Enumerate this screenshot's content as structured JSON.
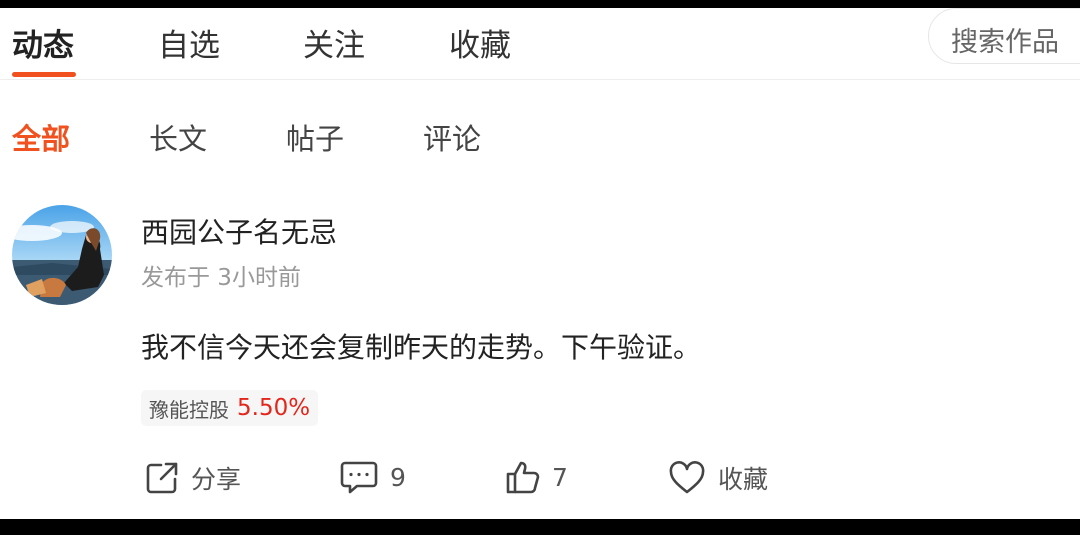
{
  "top_tabs": [
    {
      "label": "动态",
      "active": true
    },
    {
      "label": "自选",
      "active": false
    },
    {
      "label": "关注",
      "active": false
    },
    {
      "label": "收藏",
      "active": false
    }
  ],
  "search": {
    "placeholder": "搜索作品"
  },
  "sub_tabs": [
    {
      "label": "全部",
      "active": true
    },
    {
      "label": "长文",
      "active": false
    },
    {
      "label": "帖子",
      "active": false
    },
    {
      "label": "评论",
      "active": false
    }
  ],
  "post": {
    "author": "西园公子名无忌",
    "time": "发布于 3小时前",
    "content": "我不信今天还会复制昨天的走势。下午验证。",
    "stock": {
      "name": "豫能控股",
      "change": "5.50%"
    },
    "actions": {
      "share_label": "分享",
      "comment_count": "9",
      "like_count": "7",
      "favorite_label": "收藏"
    }
  },
  "colors": {
    "accent": "#f0511e",
    "rise": "#e3261b",
    "muted": "#999999"
  },
  "icons": [
    "share-icon",
    "comment-icon",
    "like-icon",
    "heart-icon"
  ]
}
